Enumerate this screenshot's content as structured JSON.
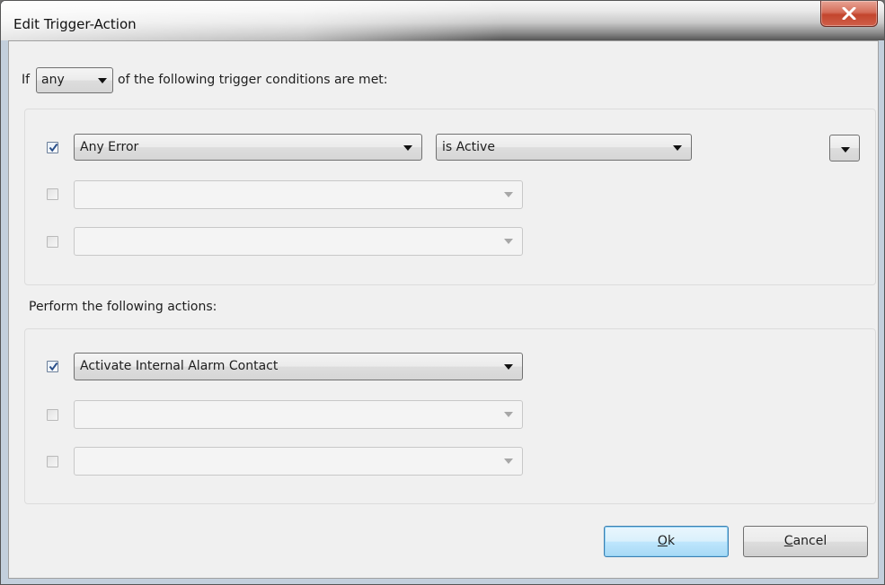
{
  "window": {
    "title": "Edit Trigger-Action"
  },
  "trigger": {
    "prefix": "If",
    "match_value": "any",
    "suffix": "of the following trigger conditions are met:",
    "rows": [
      {
        "checked": true,
        "condition": "Any Error",
        "state": "is Active",
        "enabled": true
      },
      {
        "checked": false,
        "condition": "",
        "enabled": false
      },
      {
        "checked": false,
        "condition": "",
        "enabled": false
      }
    ]
  },
  "actions": {
    "heading": "Perform the following actions:",
    "rows": [
      {
        "checked": true,
        "action": "Activate Internal Alarm Contact",
        "enabled": true
      },
      {
        "checked": false,
        "action": "",
        "enabled": false
      },
      {
        "checked": false,
        "action": "",
        "enabled": false
      }
    ]
  },
  "buttons": {
    "ok": {
      "label": "Ok",
      "mnemonic": "O",
      "rest": "k"
    },
    "cancel": {
      "label": "Cancel",
      "mnemonic": "C",
      "rest": "ancel"
    }
  },
  "icons": [
    "close-icon",
    "chevron-down-icon",
    "checkmark-icon"
  ],
  "colors": {
    "default_button": "#bee6fd",
    "close_button": "#c3452d",
    "dialog_bg": "#f0f0f0"
  }
}
